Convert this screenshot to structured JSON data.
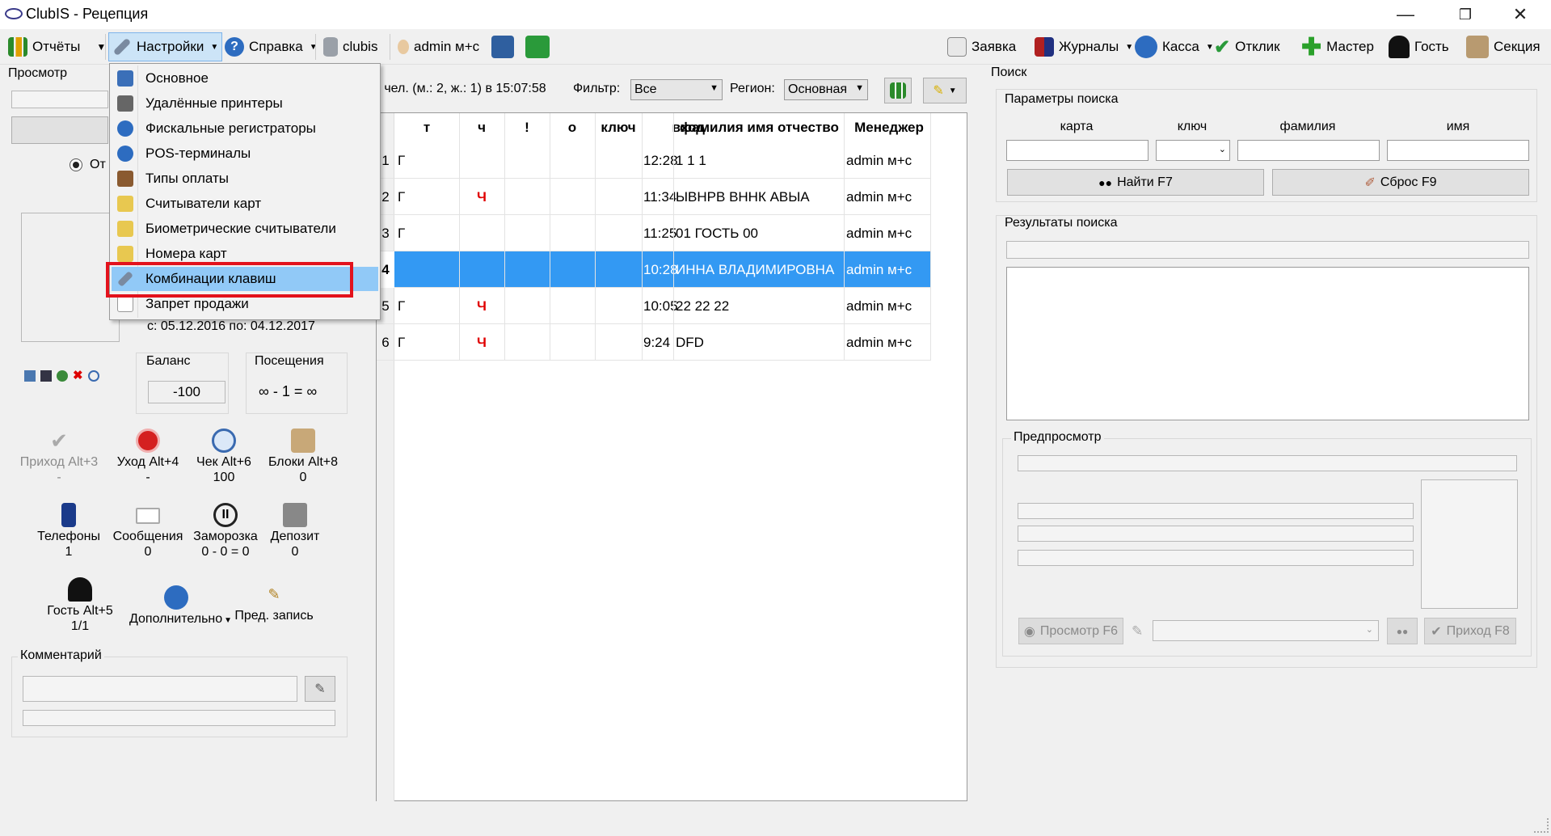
{
  "window": {
    "title": "ClubIS - Рецепция",
    "minimize": "—",
    "maximize": "❐",
    "close": "✕"
  },
  "toolbar": {
    "left": [
      {
        "label": "Отчёты",
        "icon": "chart-icon"
      },
      {
        "label": "Настройки",
        "icon": "wrench-icon"
      },
      {
        "label": "Справка",
        "icon": "help-icon"
      },
      {
        "label": "clubis",
        "icon": "database-icon"
      },
      {
        "label": "admin м+с",
        "icon": "user-icon"
      }
    ],
    "right": [
      {
        "label": "Заявка",
        "icon": "form-icon"
      },
      {
        "label": "Журналы",
        "icon": "books-icon"
      },
      {
        "label": "Касса",
        "icon": "info-icon"
      },
      {
        "label": "Отклик",
        "icon": "check-icon"
      },
      {
        "label": "Мастер",
        "icon": "plus-icon"
      },
      {
        "label": "Гость",
        "icon": "person-icon"
      },
      {
        "label": "Секция",
        "icon": "section-icon"
      }
    ]
  },
  "left_panel": {
    "view_label": "Просмотр",
    "radio_label": "От",
    "dates": "с:  05.12.2016   по:  04.12.2017",
    "balance_label": "Баланс",
    "balance_value": "-100",
    "visits_label": "Посещения",
    "visits_value": "∞ - 1 = ∞",
    "actions": [
      {
        "label": "Приход Alt+3",
        "sub": "-",
        "icon": "check-icon",
        "enabled": false
      },
      {
        "label": "Уход Alt+4",
        "sub": "-",
        "icon": "stop-icon",
        "enabled": true
      },
      {
        "label": "Чек Alt+6",
        "sub": "100",
        "icon": "magnifier-icon",
        "enabled": true
      },
      {
        "label": "Блоки Alt+8",
        "sub": "0",
        "icon": "blocks-icon",
        "enabled": true
      },
      {
        "label": "Телефоны",
        "sub": "1",
        "icon": "phone-icon",
        "enabled": true
      },
      {
        "label": "Сообщения",
        "sub": "0",
        "icon": "envelope-icon",
        "enabled": true
      },
      {
        "label": "Заморозка",
        "sub": "0 - 0 = 0",
        "icon": "pause-icon",
        "enabled": true
      },
      {
        "label": "Депозит",
        "sub": "0",
        "icon": "safe-icon",
        "enabled": true
      },
      {
        "label": "Гость Alt+5",
        "sub": "1/1",
        "icon": "guest-icon",
        "enabled": true
      },
      {
        "label": "Дополнительно",
        "sub": "",
        "icon": "info-icon",
        "enabled": true
      },
      {
        "label": "Пред. запись",
        "sub": "",
        "icon": "pencil-icon",
        "enabled": true
      }
    ],
    "comment_label": "Комментарий"
  },
  "menu": {
    "items": [
      {
        "label": "Основное",
        "icon": "monitor-icon"
      },
      {
        "label": "Удалённые принтеры",
        "icon": "printer-icon"
      },
      {
        "label": "Фискальные регистраторы",
        "icon": "info-icon"
      },
      {
        "label": "POS-терминалы",
        "icon": "info-icon"
      },
      {
        "label": "Типы оплаты",
        "icon": "wallet-icon"
      },
      {
        "label": "Считыватели карт",
        "icon": "card-reader-icon"
      },
      {
        "label": "Биометрические считыватели",
        "icon": "card-reader-icon"
      },
      {
        "label": "Номера карт",
        "icon": "card-reader-icon"
      },
      {
        "label": "Комбинации клавиш",
        "icon": "wrench-icon"
      },
      {
        "label": "Запрет продажи",
        "icon": "list-icon"
      }
    ]
  },
  "visits": {
    "summary": "6 чел. (м.: 2, ж.: 1) в 15:07:58",
    "filter_label": "Фильтр:",
    "filter_value": "Все",
    "region_label": "Регион:",
    "region_value": "Основная",
    "columns": [
      "т",
      "ч",
      "!",
      "о",
      "ключ",
      "вход",
      "фамилия имя отчество",
      "Менеджер"
    ],
    "rows": [
      {
        "n": "1",
        "t": "Г",
        "ch": "",
        "time": "12:28",
        "name": "1 1 1",
        "manager": "admin м+с",
        "selected": false
      },
      {
        "n": "2",
        "t": "Г",
        "ch": "Ч",
        "time": "11:34",
        "name": "ЫВНРВ ВННК АВЫА",
        "manager": "admin м+с",
        "selected": false
      },
      {
        "n": "3",
        "t": "Г",
        "ch": "",
        "time": "11:25",
        "name": "01 ГОСТЬ 00",
        "manager": "admin м+с",
        "selected": false
      },
      {
        "n": "4",
        "t": "",
        "ch": "",
        "time": "10:28",
        "name": " ИННА ВЛАДИМИРОВНА",
        "manager": "admin м+с",
        "selected": true
      },
      {
        "n": "5",
        "t": "Г",
        "ch": "Ч",
        "time": "10:05",
        "name": "22 22 22",
        "manager": "admin м+с",
        "selected": false
      },
      {
        "n": "6",
        "t": "Г",
        "ch": "Ч",
        "time": "9:24",
        "name": " DFD",
        "manager": "admin м+с",
        "selected": false
      }
    ]
  },
  "search": {
    "title": "Поиск",
    "params_label": "Параметры поиска",
    "col_card": "карта",
    "col_key": "ключ",
    "col_surname": "фамилия",
    "col_name": "имя",
    "find_button": "Найти F7",
    "reset_button": "Сброс F9",
    "results_label": "Результаты поиска",
    "preview_label": "Предпросмотр",
    "view_button": "Просмотр F6",
    "arrive_button": "Приход F8"
  }
}
